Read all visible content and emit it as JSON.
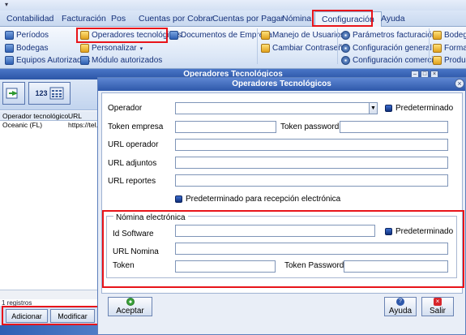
{
  "quick_access": "▾",
  "tabs": [
    "Contabilidad",
    "Facturación",
    "Pos",
    "Cuentas por Cobrar",
    "Cuentas por Pagar",
    "Nómina",
    "Configuración",
    "Ayuda"
  ],
  "ribbon": {
    "col1": [
      "Períodos",
      "Bodegas",
      "Equipos Autorizados"
    ],
    "col2": [
      "Operadores tecnológicos",
      "Personalizar",
      "Módulo autorizados"
    ],
    "col2b": [
      "Documentos de Empresa"
    ],
    "col3": [
      "Manejo de Usuarios",
      "Cambiar Contraseña"
    ],
    "col4": [
      "Parámetros facturación",
      "Configuración general",
      "Configuración comercial"
    ],
    "col5": [
      "Bodega",
      "Formas",
      "Product"
    ]
  },
  "bg_window": {
    "title": "Operadores Tecnológicos",
    "toolbar_label": "123",
    "grid_headers": [
      "Operador tecnológico",
      "URL"
    ],
    "row": [
      "Oceanic (FL)",
      "https://tel..."
    ],
    "count": "1 registros",
    "add_label": "Adicionar",
    "edit_label": "Modificar"
  },
  "dialog": {
    "title": "Operadores Tecnológicos",
    "operador_label": "Operador",
    "operador_value": "",
    "predeterminado": "Predeterminado",
    "token_empresa": "Token empresa",
    "token_password": "Token password",
    "url_operador": "URL operador",
    "url_adjuntos": "URL adjuntos",
    "url_reportes": "URL reportes",
    "predet_recepcion": "Predeterminado para recepción electrónica",
    "nomina": {
      "legend": "Nómina electrónica",
      "id_software": "Id Software",
      "predeterminado": "Predeterminado",
      "url_nomina": "URL Nomina",
      "token": "Token",
      "token_password": "Token Password"
    },
    "accept": "Aceptar",
    "help": "Ayuda",
    "exit": "Salir"
  },
  "colors": {
    "highlight": "#e8141a",
    "title_bar": "#2e58aa",
    "ribbon_text": "#15317a"
  }
}
